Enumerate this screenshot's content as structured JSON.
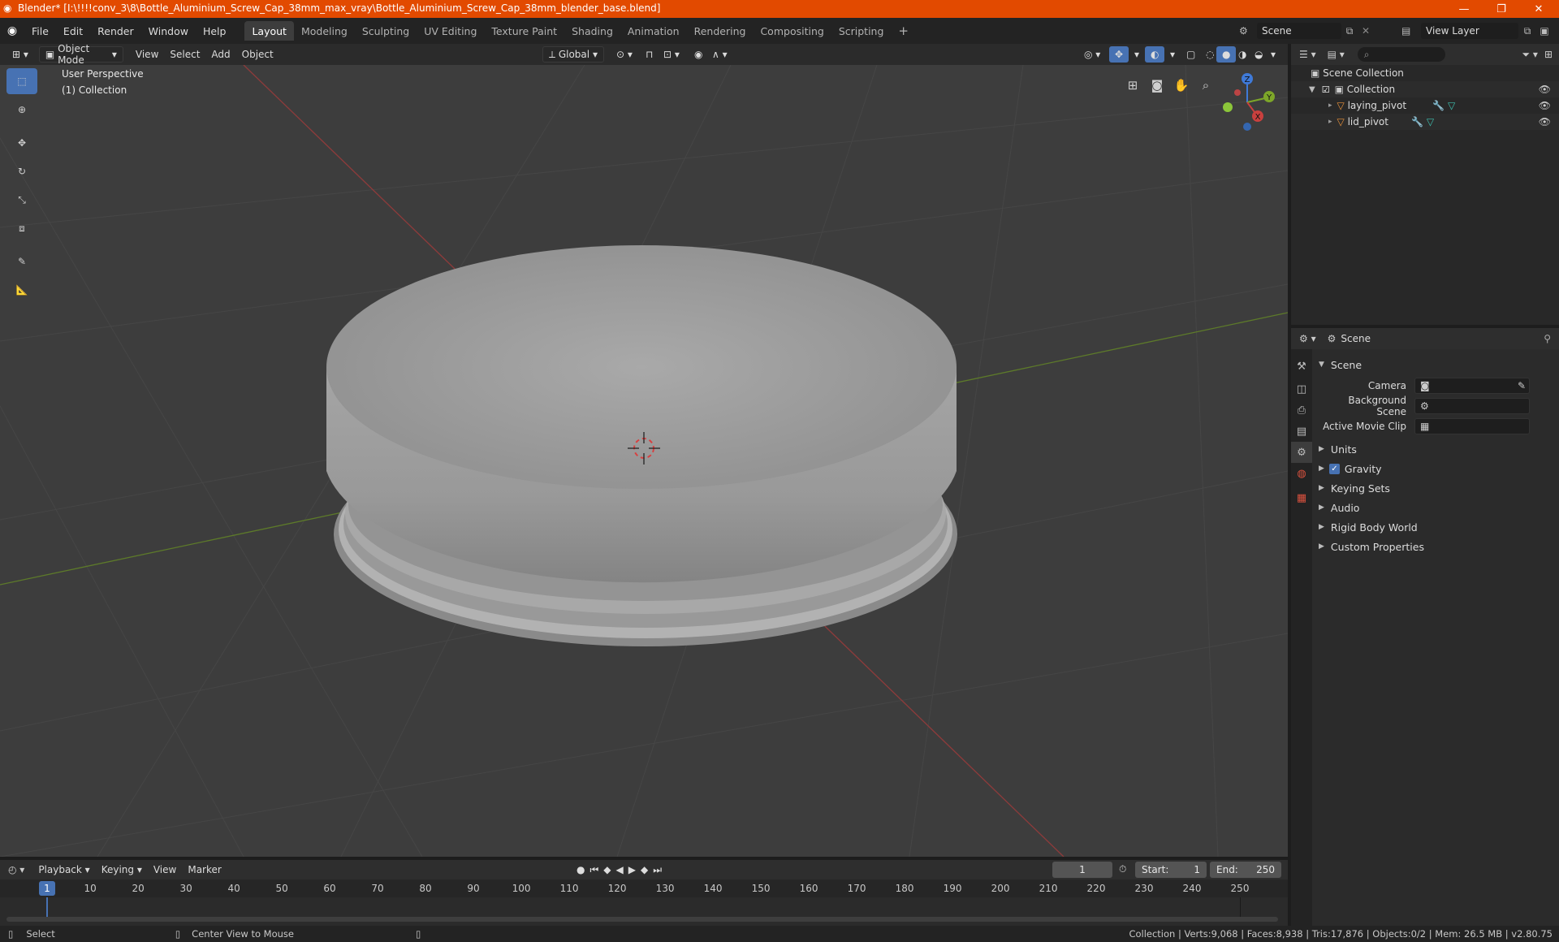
{
  "window": {
    "title": "Blender* [I:\\!!!!conv_3\\8\\Bottle_Aluminium_Screw_Cap_38mm_max_vray\\Bottle_Aluminium_Screw_Cap_38mm_blender_base.blend]",
    "minimize": "—",
    "maximize": "❐",
    "close": "✕"
  },
  "menubar": {
    "items": [
      "File",
      "Edit",
      "Render",
      "Window",
      "Help"
    ],
    "workspaces": [
      "Layout",
      "Modeling",
      "Sculpting",
      "UV Editing",
      "Texture Paint",
      "Shading",
      "Animation",
      "Rendering",
      "Compositing",
      "Scripting"
    ],
    "active_workspace": "Layout",
    "add_tab": "+",
    "scene_name": "Scene",
    "view_layer": "View Layer"
  },
  "viewport_header": {
    "mode": "Object Mode",
    "menus": [
      "View",
      "Select",
      "Add",
      "Object"
    ],
    "transform_orientation": "Global"
  },
  "viewport": {
    "perspective": "User Perspective",
    "collection": "(1) Collection",
    "gizmo": {
      "x": "X",
      "y": "Y",
      "z": "Z"
    }
  },
  "outliner": {
    "root": "Scene Collection",
    "collection": "Collection",
    "objects": [
      "laying_pivot",
      "lid_pivot"
    ]
  },
  "properties": {
    "context": "Scene",
    "section": "Scene",
    "fields": [
      {
        "label": "Camera",
        "value": ""
      },
      {
        "label": "Background Scene",
        "value": ""
      },
      {
        "label": "Active Movie Clip",
        "value": ""
      }
    ],
    "panels": [
      "Units",
      "Gravity",
      "Keying Sets",
      "Audio",
      "Rigid Body World",
      "Custom Properties"
    ],
    "gravity_checked": true
  },
  "timeline": {
    "menus": [
      "Playback",
      "Keying",
      "View",
      "Marker"
    ],
    "current_frame": "1",
    "start_label": "Start:",
    "start": "1",
    "end_label": "End:",
    "end": "250",
    "ticks": [
      "1",
      "10",
      "20",
      "30",
      "40",
      "50",
      "60",
      "70",
      "80",
      "90",
      "100",
      "110",
      "120",
      "130",
      "140",
      "150",
      "160",
      "170",
      "180",
      "190",
      "200",
      "210",
      "220",
      "230",
      "240",
      "250"
    ]
  },
  "statusbar": {
    "select": "Select",
    "center_view": "Center View to Mouse",
    "stats": "Collection | Verts:9,068 | Faces:8,938 | Tris:17,876 | Objects:0/2 | Mem: 26.5 MB | v2.80.75"
  },
  "colors": {
    "titlebar": "#e24a00",
    "accent": "#4772b3",
    "viewport_bg": "#3d3d3d",
    "x_axis": "#c9403e",
    "y_axis": "#7da629",
    "z_axis": "#3f7ad8"
  }
}
